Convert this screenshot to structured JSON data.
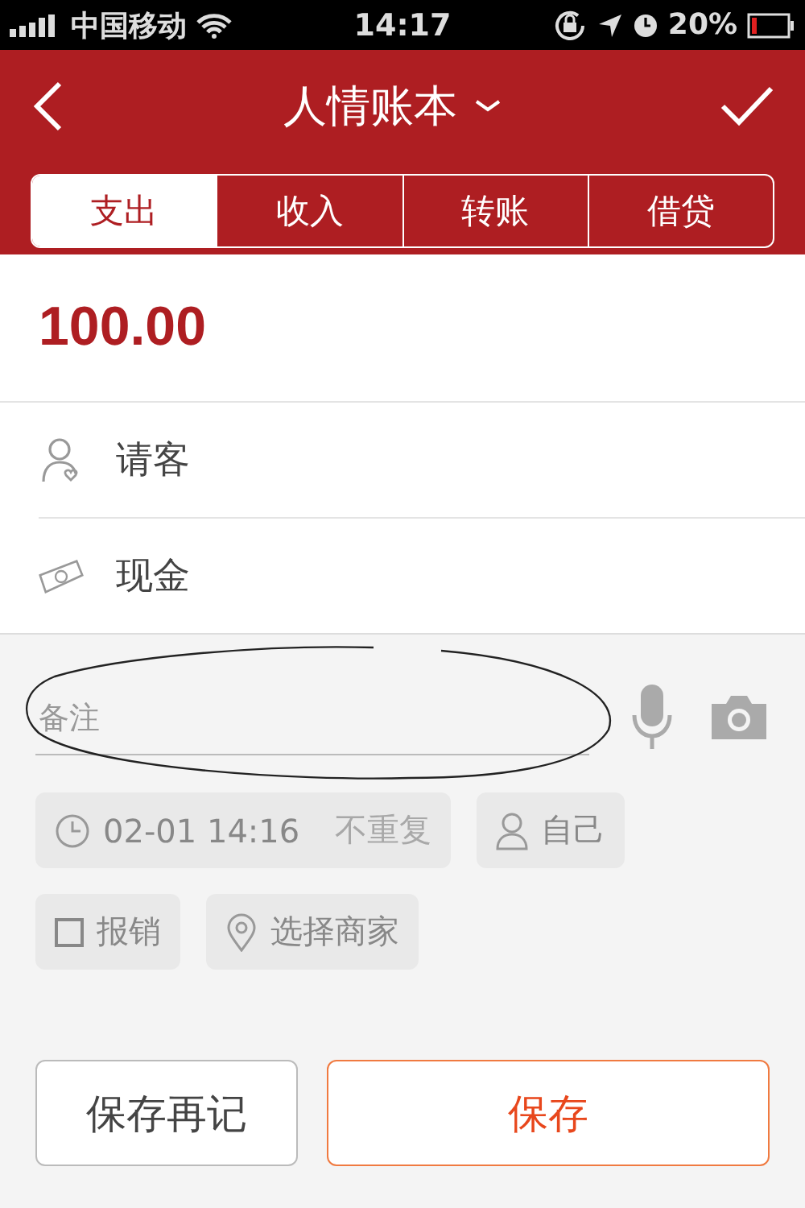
{
  "status_bar": {
    "carrier": "中国移动",
    "time": "14:17",
    "battery": "20%"
  },
  "header": {
    "title": "人情账本"
  },
  "tabs": [
    {
      "label": "支出",
      "selected": true
    },
    {
      "label": "收入",
      "selected": false
    },
    {
      "label": "转账",
      "selected": false
    },
    {
      "label": "借贷",
      "selected": false
    }
  ],
  "amount": "100.00",
  "fields": [
    {
      "kind": "category",
      "value": "请客"
    },
    {
      "kind": "account",
      "value": "现金"
    }
  ],
  "note": {
    "placeholder": "备注"
  },
  "datetime": "02-01 14:16",
  "repeat": "不重复",
  "member": "自己",
  "reimburse": {
    "label": "报销",
    "checked": false
  },
  "merchant": "选择商家",
  "buttons": [
    {
      "label": "保存再记",
      "kind": "secondary"
    },
    {
      "label": "保存",
      "kind": "primary"
    }
  ]
}
